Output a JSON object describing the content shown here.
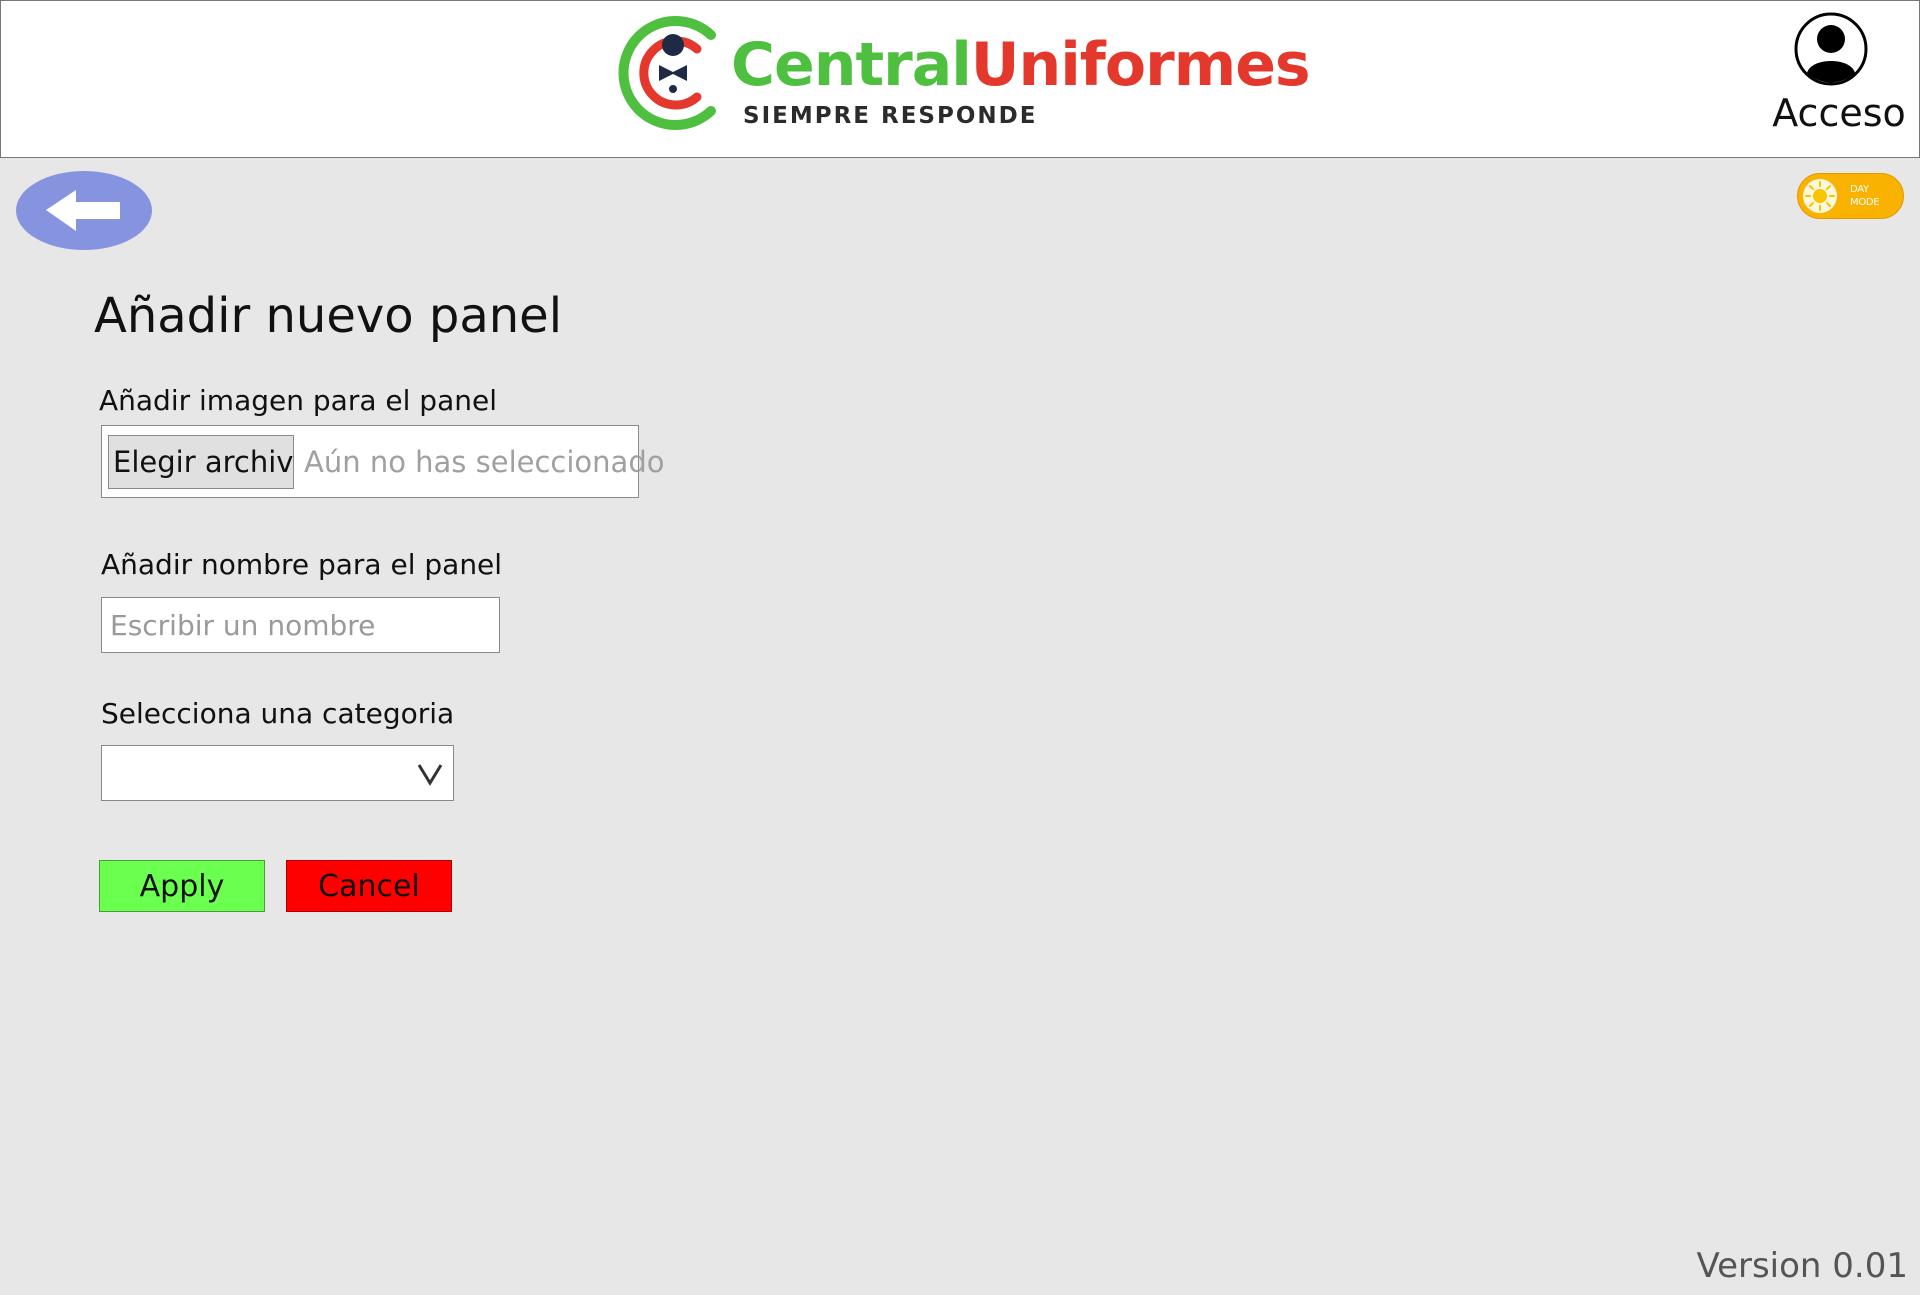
{
  "header": {
    "brand": {
      "name_part1": "Central",
      "name_part2": "Uniformes",
      "tagline": "SIEMPRE RESPONDE"
    },
    "login_label": "Acceso"
  },
  "theme_toggle": {
    "line1": "DAY",
    "line2": "MODE",
    "color": "#f9b200"
  },
  "form": {
    "title": "Añadir nuevo panel",
    "image_label": "Añadir imagen para el panel",
    "file_button_label": "Elegir archivo",
    "file_status": "Aún no has seleccionado",
    "name_label": "Añadir nombre para el panel",
    "name_placeholder": "Escribir un nombre",
    "name_value": "",
    "category_label": "Selecciona una categoria",
    "category_selected": "",
    "apply_label": "Apply",
    "cancel_label": "Cancel"
  },
  "colors": {
    "back_button": "#8694e0",
    "apply": "#6bff4f",
    "cancel": "#ff0000",
    "brand_green": "#4fbf3f",
    "brand_red": "#e4382c"
  },
  "icons": {
    "back": "arrow-left-icon",
    "login": "user-circle-icon",
    "theme": "sun-icon",
    "select": "chevron-down-icon"
  },
  "footer": {
    "version": "Version 0.01"
  }
}
